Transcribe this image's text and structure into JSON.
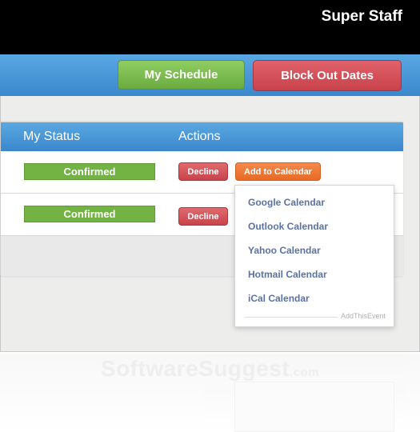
{
  "header": {
    "title": "Super Staff"
  },
  "nav": {
    "my_schedule": "My Schedule",
    "block_out_dates": "Block Out Dates"
  },
  "table": {
    "columns": [
      "My Status",
      "Actions"
    ],
    "rows": [
      {
        "status": "Confirmed",
        "decline": "Decline",
        "add_to_calendar": "Add to Calendar"
      },
      {
        "status": "Confirmed",
        "decline": "Decline"
      }
    ]
  },
  "calendar_menu": {
    "items": [
      "Google Calendar",
      "Outlook Calendar",
      "Yahoo Calendar",
      "Hotmail Calendar",
      "iCal Calendar"
    ],
    "brand": "AddThisEvent"
  },
  "watermark": {
    "name": "SoftwareSuggest",
    "suffix": ".com"
  },
  "colors": {
    "header_bg": "#000000",
    "bar_blue": "#4a98d8",
    "schedule_green": "#7dbd50",
    "block_red": "#d4525a",
    "status_green": "#72b344",
    "decline_red": "#d4565c",
    "calendar_orange": "#ee7a35",
    "menu_link": "#5a72a8"
  }
}
